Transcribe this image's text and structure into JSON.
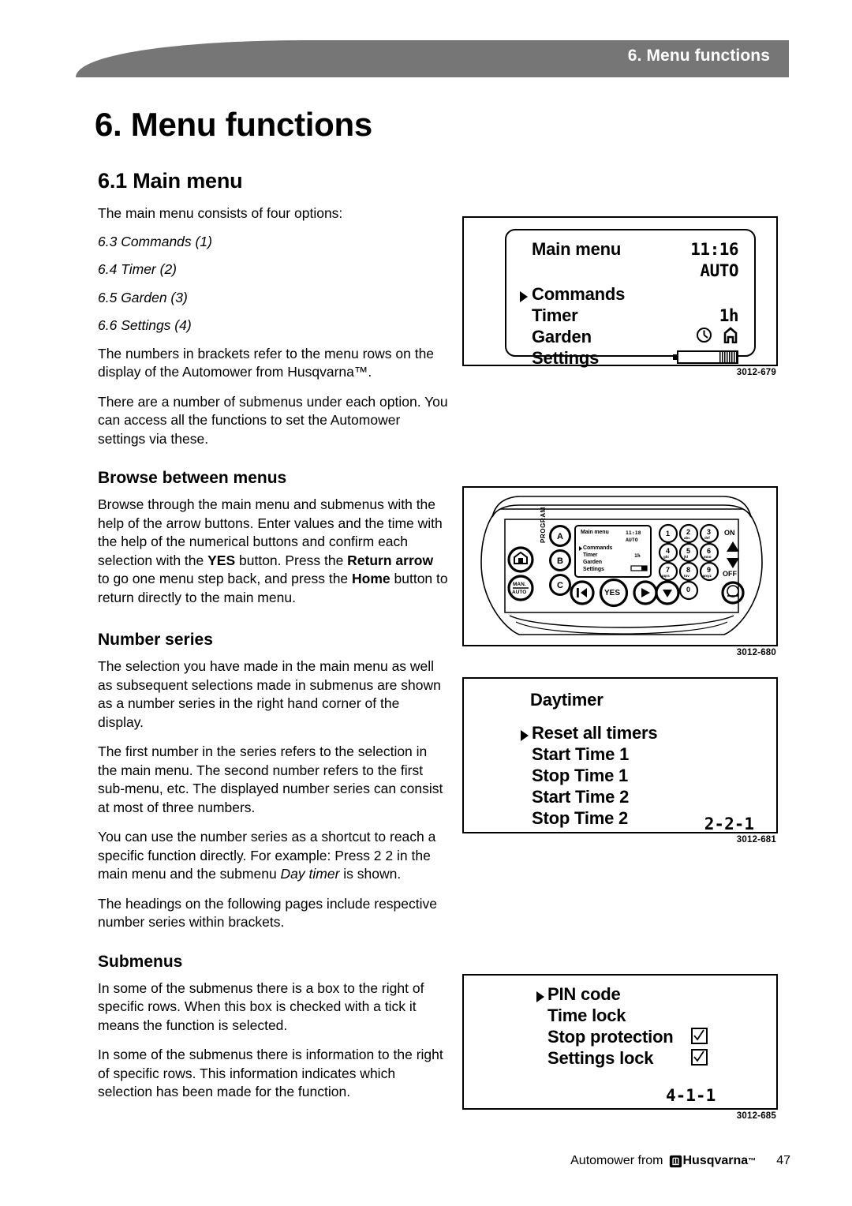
{
  "header": {
    "running_title": "6. Menu functions"
  },
  "page_title": "6. Menu functions",
  "sections": {
    "main_menu": {
      "heading": "6.1 Main menu",
      "intro": "The main menu consists of four options:",
      "options": [
        "6.3 Commands (1)",
        "6.4 Timer (2)",
        "6.5 Garden (3)",
        "6.6 Settings (4)"
      ],
      "para_brackets": "The numbers in brackets refer to the menu rows on the display of the Automower from Husqvarna™.",
      "para_submenus": "There are a number of submenus under each option. You can access all the functions to set the Automower settings via these."
    },
    "browse": {
      "heading": "Browse between menus",
      "paragraph_parts": [
        "Browse through the main menu and submenus with the help of the arrow buttons. Enter values and the time with the help of the numerical buttons and confirm each selection with the ",
        "YES",
        " button. Press the ",
        "Return arrow",
        " to go one menu step back, and press the ",
        "Home",
        " button to return directly to the main menu."
      ]
    },
    "number_series": {
      "heading": "Number series",
      "p1": "The selection you have made in the main menu as well as subsequent selections made in submenus are shown as a number series in the right hand corner of the display.",
      "p2": "The first number in the series refers to the selection in the main menu. The second number refers to the first sub-menu, etc. The displayed number series can consist at most of three numbers.",
      "p3_parts": [
        "You can use the number series as a shortcut to reach a specific function directly. For example: Press 2 2 in the main menu and the submenu ",
        "Day timer",
        " is shown."
      ],
      "p4": "The headings on the following pages include respective number series within brackets."
    },
    "submenus": {
      "heading": "Submenus",
      "p1": "In some of the submenus there is a box to the right of specific rows. When this box is checked with a tick it means the function is selected.",
      "p2": "In some of the submenus there is information to the right of specific rows. This information indicates which selection has been made for the function."
    }
  },
  "figures": {
    "main_menu_display": {
      "id": "3012-679",
      "title": "Main menu",
      "time": "11:16",
      "mode": "AUTO",
      "rows": [
        {
          "label": "Commands",
          "value": "",
          "cursor": true
        },
        {
          "label": "Timer",
          "value": "1h",
          "cursor": false
        },
        {
          "label": "Garden",
          "value": "icons",
          "cursor": false
        },
        {
          "label": "Settings",
          "value": "battery",
          "cursor": false
        }
      ]
    },
    "control_panel": {
      "id": "3012-680",
      "program_label": "PROGRAM",
      "program_buttons": [
        "A",
        "B",
        "C"
      ],
      "left_buttons": [
        "home-icon",
        "MAN./AUTO"
      ],
      "action_buttons": [
        "return-arrow",
        "YES",
        "right-arrow",
        "down-arrow"
      ],
      "keypad": [
        {
          "digit": "1",
          "letters": ""
        },
        {
          "digit": "2",
          "letters": "abc"
        },
        {
          "digit": "3",
          "letters": "def"
        },
        {
          "digit": "4",
          "letters": "ghi"
        },
        {
          "digit": "5",
          "letters": "jkl"
        },
        {
          "digit": "6",
          "letters": "mno"
        },
        {
          "digit": "7",
          "letters": "pqrs"
        },
        {
          "digit": "8",
          "letters": "tuv"
        },
        {
          "digit": "9",
          "letters": "wxyz"
        },
        {
          "digit": "0",
          "letters": ""
        }
      ],
      "power_on": "ON",
      "power_off": "OFF",
      "man_auto_top": "MAN.",
      "man_auto_bottom": "AUTO",
      "lcd": {
        "title": "Main menu",
        "time": "11:18",
        "mode": "AUTO",
        "rows": [
          "Commands",
          "Timer",
          "Garden",
          "Settings"
        ],
        "timer_value": "1h"
      }
    },
    "daytimer_display": {
      "id": "3012-681",
      "title": "Daytimer",
      "rows": [
        {
          "label": "Reset all timers",
          "cursor": true
        },
        {
          "label": "Start Time 1",
          "cursor": false
        },
        {
          "label": "Stop Time 1",
          "cursor": false
        },
        {
          "label": "Start Time 2",
          "cursor": false
        },
        {
          "label": "Stop Time 2",
          "cursor": false
        }
      ],
      "number_series": "2-2-1"
    },
    "pincode_display": {
      "id": "3012-685",
      "rows": [
        {
          "label": "PIN code",
          "cursor": true,
          "checked": false
        },
        {
          "label": "Time lock",
          "cursor": false,
          "checked": false
        },
        {
          "label": "Stop protection",
          "cursor": false,
          "checked": true
        },
        {
          "label": "Settings lock",
          "cursor": false,
          "checked": true
        }
      ],
      "number_series": "4-1-1"
    }
  },
  "footer": {
    "prefix": "Automower from",
    "brand": "Husqvarna",
    "tm": "™",
    "page_number": "47"
  },
  "colors": {
    "header_band": "#767676",
    "ink": "#000000",
    "paper": "#ffffff"
  }
}
